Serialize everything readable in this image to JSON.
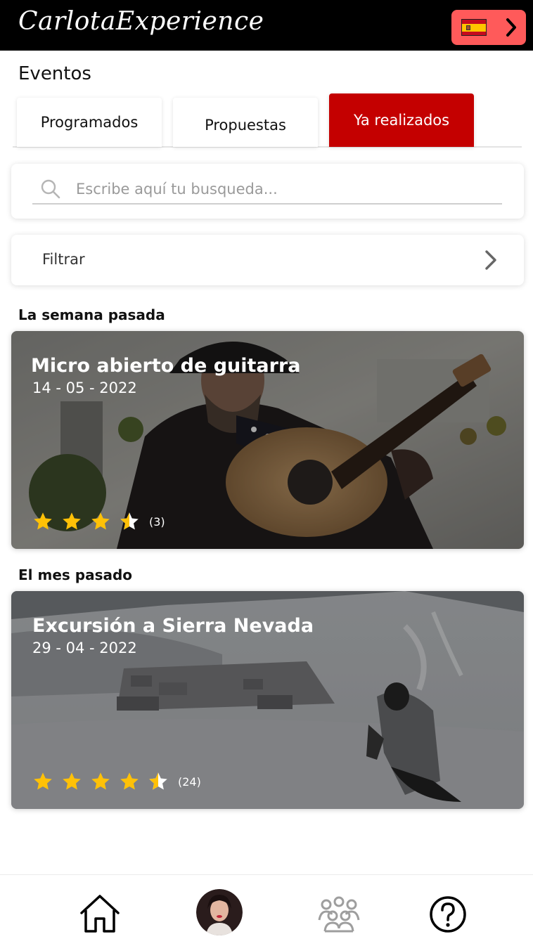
{
  "header": {
    "brand": "CarlotaExperience",
    "language_button_icon": "spain-flag-icon",
    "language_button_chevron": "chevron-right-icon"
  },
  "page": {
    "title": "Eventos"
  },
  "tabs": [
    {
      "label": "Programados",
      "active": false
    },
    {
      "label": "Propuestas",
      "active": false
    },
    {
      "label": "Ya realizados",
      "active": true
    }
  ],
  "search": {
    "icon": "search-icon",
    "placeholder": "Escribe aquí tu busqueda..."
  },
  "filter": {
    "label": "Filtrar",
    "icon": "chevron-right-icon"
  },
  "sections": [
    {
      "title": "La semana pasada",
      "events": [
        {
          "title": "Micro abierto de guitarra",
          "date": "14 - 05 - 2022",
          "rating": 3.5,
          "count_label": "(3)"
        }
      ]
    },
    {
      "title": "El mes pasado",
      "events": [
        {
          "title": "Excursión a Sierra Nevada",
          "date": "29 - 04 - 2022",
          "rating": 4.5,
          "count_label": "(24)"
        }
      ]
    }
  ],
  "bottom_nav": {
    "items": [
      {
        "name": "home",
        "icon": "home-icon"
      },
      {
        "name": "profile",
        "icon": "avatar"
      },
      {
        "name": "community",
        "icon": "group-icon"
      },
      {
        "name": "help",
        "icon": "help-icon"
      }
    ]
  },
  "colors": {
    "header_bg": "#000000",
    "accent": "#c40000",
    "language_button": "#ff5a5a",
    "star": "#ffc107"
  }
}
